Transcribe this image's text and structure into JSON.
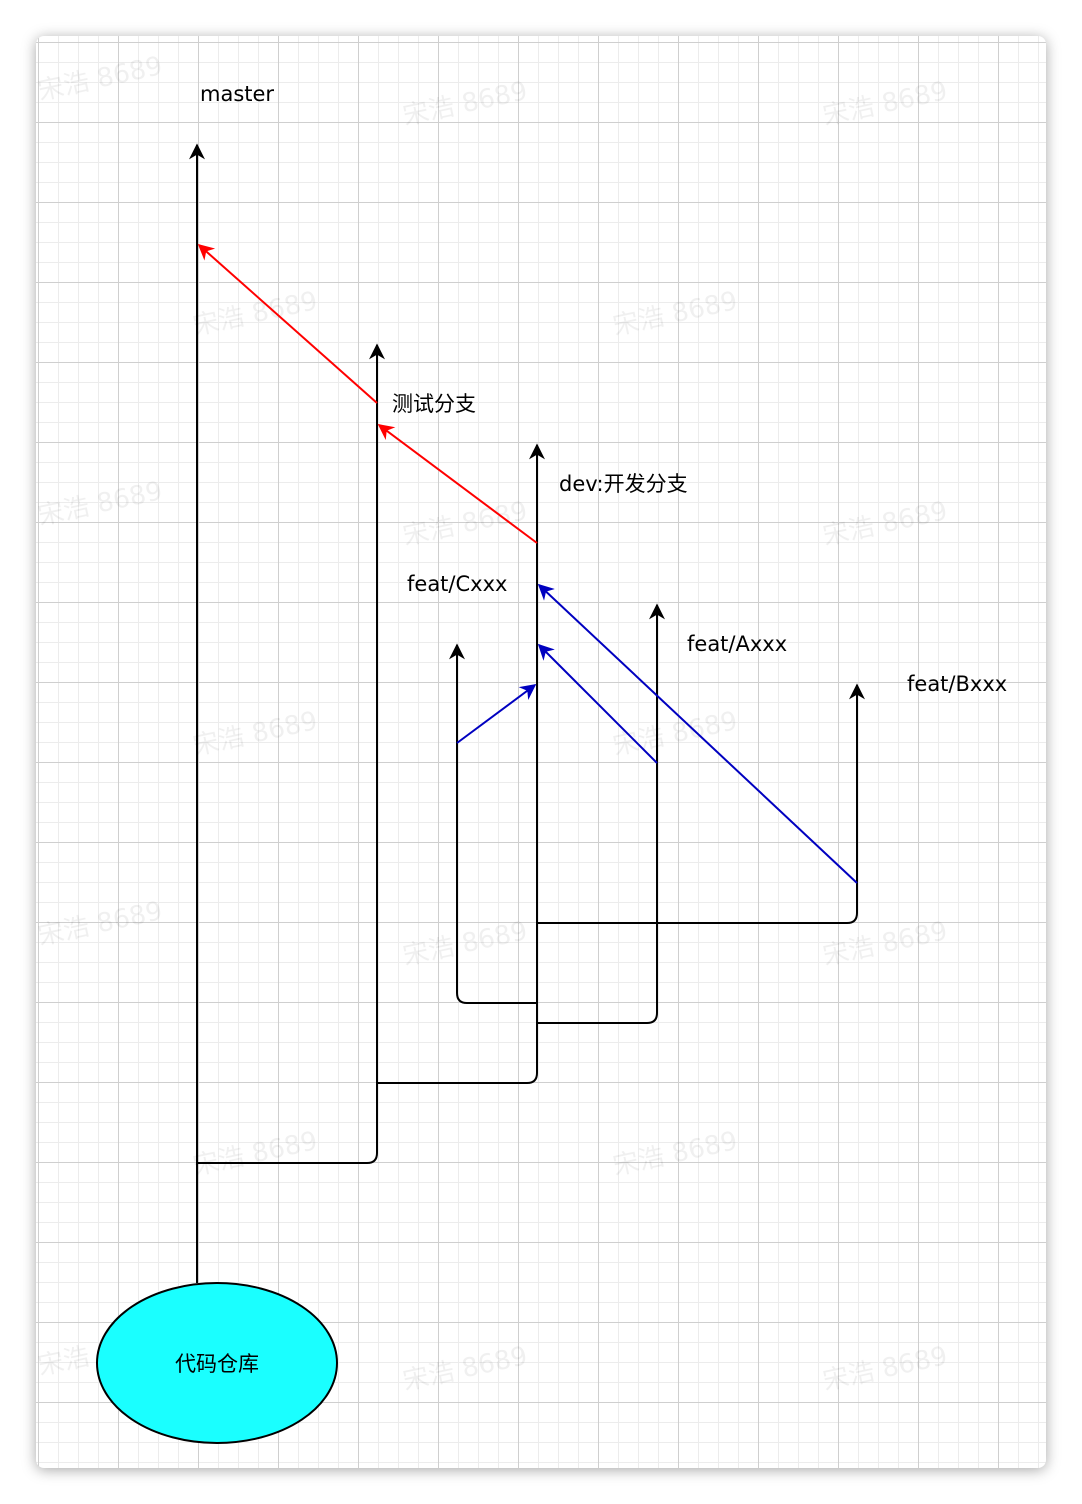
{
  "labels": {
    "master": "master",
    "test_branch": "测试分支",
    "dev_branch": "dev:开发分支",
    "feat_c": "feat/Cxxx",
    "feat_a": "feat/Axxx",
    "feat_b": "feat/Bxxx",
    "repo": "代码仓库"
  },
  "watermark": "宋浩 8689",
  "colors": {
    "branch_line": "#000000",
    "merge_release": "#ff0000",
    "merge_feature": "#0000c0",
    "repo_fill": "#1affff"
  }
}
